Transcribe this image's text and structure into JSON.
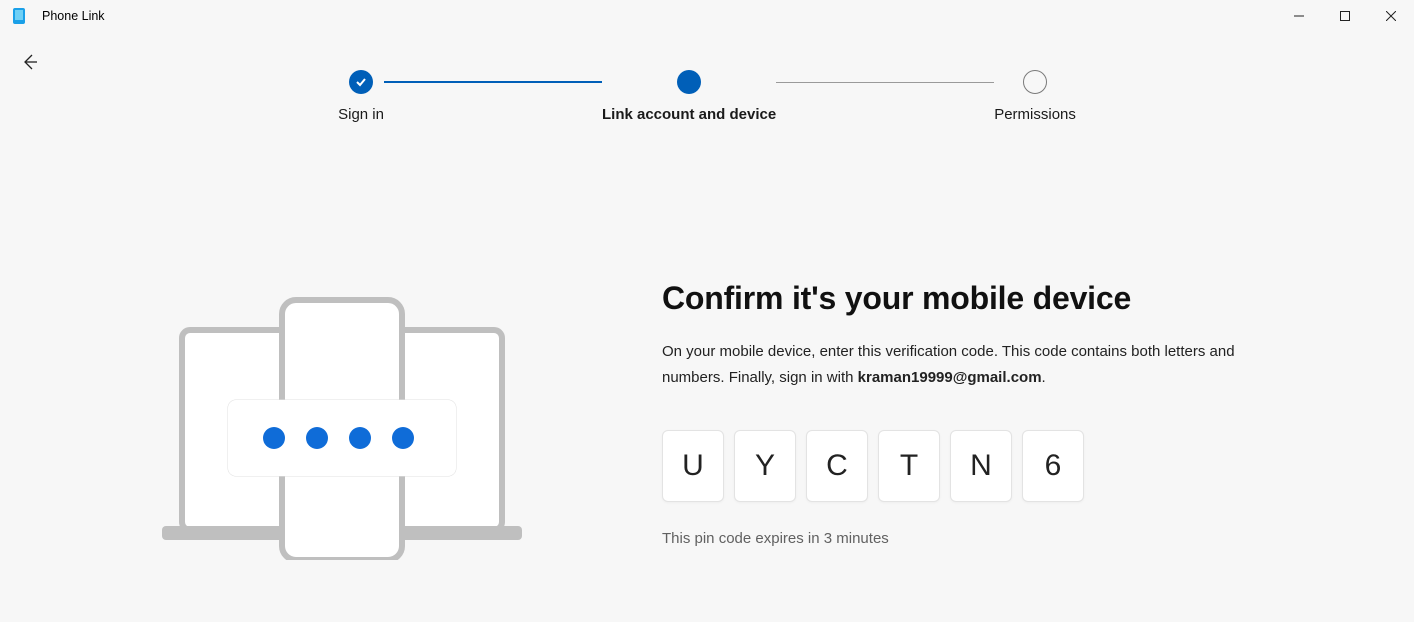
{
  "app": {
    "title": "Phone Link"
  },
  "stepper": {
    "steps": [
      {
        "label": "Sign in",
        "state": "done"
      },
      {
        "label": "Link account and device",
        "state": "current"
      },
      {
        "label": "Permissions",
        "state": "pending"
      }
    ]
  },
  "content": {
    "heading": "Confirm it's your mobile device",
    "desc_prefix": "On your mobile device, enter this verification code. This code contains both letters and numbers. Finally, sign in with ",
    "email": "kraman19999@gmail.com",
    "desc_suffix": ".",
    "code": [
      "U",
      "Y",
      "C",
      "T",
      "N",
      "6"
    ],
    "expiry": "This pin code expires in 3 minutes"
  },
  "colors": {
    "accent": "#005fb8"
  }
}
